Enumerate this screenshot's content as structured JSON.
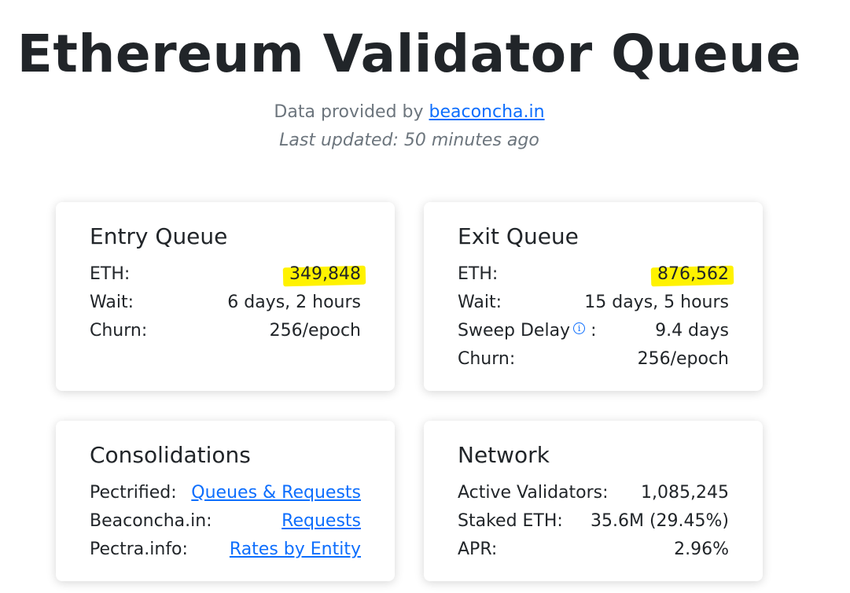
{
  "header": {
    "title": "Ethereum Validator Queue",
    "provided_prefix": "Data provided by",
    "provided_link": "beaconcha.in",
    "last_updated": "Last updated: 50 minutes ago"
  },
  "entry_queue": {
    "title": "Entry Queue",
    "rows": [
      {
        "label": "ETH:",
        "value": "349,848"
      },
      {
        "label": "Wait:",
        "value": "6 days, 2 hours"
      },
      {
        "label": "Churn:",
        "value": "256/epoch"
      }
    ]
  },
  "exit_queue": {
    "title": "Exit Queue",
    "rows": [
      {
        "label": "ETH:",
        "value": "876,562"
      },
      {
        "label": "Wait:",
        "value": "15 days, 5 hours"
      },
      {
        "label": "Sweep Delay",
        "label_suffix": ":",
        "value": "9.4 days",
        "icon": "info-icon"
      },
      {
        "label": "Churn:",
        "value": "256/epoch"
      }
    ]
  },
  "consolidations": {
    "title": "Consolidations",
    "rows": [
      {
        "label": "Pectrified:",
        "value": "Queues & Requests"
      },
      {
        "label": "Beaconcha.in:",
        "value": "Requests"
      },
      {
        "label": "Pectra.info:",
        "value": "Rates by Entity"
      }
    ]
  },
  "network": {
    "title": "Network",
    "rows": [
      {
        "label": "Active Validators:",
        "value": "1,085,245"
      },
      {
        "label": "Staked ETH:",
        "value": "35.6M (29.45%)"
      },
      {
        "label": "APR:",
        "value": "2.96%"
      }
    ]
  },
  "colors": {
    "link": "#0d6efd",
    "highlight": "#fff200",
    "muted": "#6c757d",
    "text": "#212529"
  }
}
